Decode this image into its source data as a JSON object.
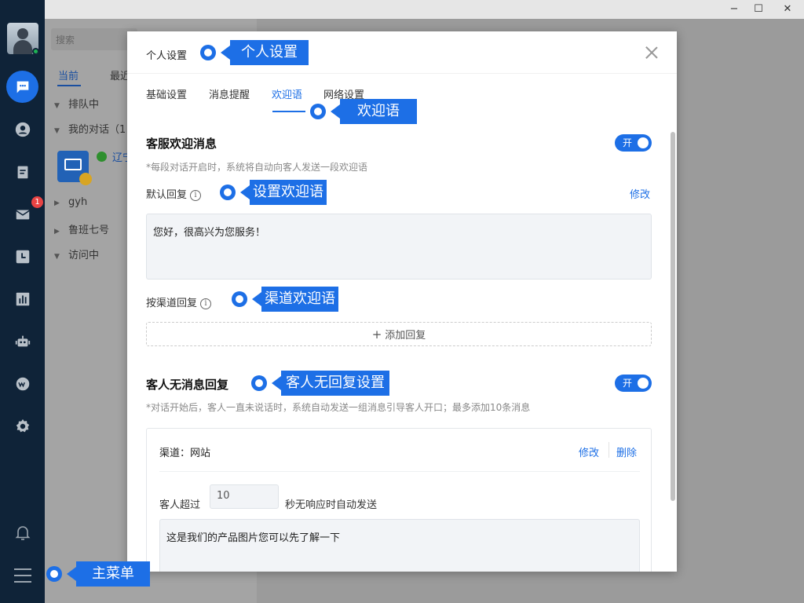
{
  "window": {
    "controls": {
      "minimize": "−",
      "maximize": "☐",
      "close": "✕"
    }
  },
  "leftnav": {
    "items": [
      {
        "icon": "chat-icon",
        "active": true
      },
      {
        "icon": "contacts-icon"
      },
      {
        "icon": "clipboard-icon"
      },
      {
        "icon": "mail-icon",
        "badge": "1"
      },
      {
        "icon": "history-icon"
      },
      {
        "icon": "stats-icon"
      },
      {
        "icon": "robot-icon"
      },
      {
        "icon": "weibo-icon"
      },
      {
        "icon": "gear-icon"
      }
    ],
    "bottom": {
      "bell": "bell-icon",
      "menu": "hamburger-icon"
    }
  },
  "convpane": {
    "search_placeholder": "搜索",
    "tabs": [
      "当前",
      "最近"
    ],
    "tree": [
      {
        "label": "排队中"
      },
      {
        "label": "我的对话（1"
      },
      {
        "label": "gyh"
      },
      {
        "label": "鲁班七号"
      },
      {
        "label": "访问中"
      }
    ],
    "conversation_link": "辽宁"
  },
  "modal": {
    "title": "个人设置",
    "tabs": [
      "基础设置",
      "消息提醒",
      "欢迎语",
      "网络设置"
    ],
    "active_tab": "欢迎语",
    "section1": {
      "title": "客服欢迎消息",
      "toggle": "开",
      "desc": "*每段对话开启时，系统将自动向客人发送一段欢迎语",
      "default_reply_label": "默认回复",
      "edit": "修改",
      "greeting": "您好，很高兴为您服务！",
      "channel_reply_label": "按渠道回复",
      "add_reply": "添加回复"
    },
    "section2": {
      "title": "客人无消息回复",
      "toggle": "开",
      "desc": "*对话开始后，客人一直未说话时，系统自动发送一组消息引导客人开口；最多添加10条消息",
      "channel_label": "渠道：网站",
      "edit": "修改",
      "delete": "删除",
      "timeout_prefix": "客人超过",
      "timeout_value": "10",
      "timeout_suffix": "秒无响应时自动发送",
      "message": "这是我们的产品图片您可以先了解一下"
    }
  },
  "callouts": {
    "personal_settings": "个人设置",
    "welcome": "欢迎语",
    "set_welcome": "设置欢迎语",
    "channel_welcome": "渠道欢迎语",
    "no_reply": "客人无回复设置",
    "main_menu": "主菜单"
  },
  "colors": {
    "accent": "#1d6fe6",
    "nav_bg": "#0f2338",
    "badge": "#e84343"
  }
}
